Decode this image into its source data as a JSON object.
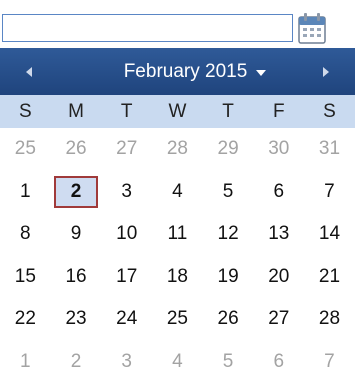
{
  "date_input": {
    "value": "",
    "placeholder": ""
  },
  "calendar": {
    "title": "February 2015",
    "weekdays": [
      "S",
      "M",
      "T",
      "W",
      "T",
      "F",
      "S"
    ],
    "weeks": [
      [
        "25",
        "26",
        "27",
        "28",
        "29",
        "30",
        "31"
      ],
      [
        "1",
        "2",
        "3",
        "4",
        "5",
        "6",
        "7"
      ],
      [
        "8",
        "9",
        "10",
        "11",
        "12",
        "13",
        "14"
      ],
      [
        "15",
        "16",
        "17",
        "18",
        "19",
        "20",
        "21"
      ],
      [
        "22",
        "23",
        "24",
        "25",
        "26",
        "27",
        "28"
      ],
      [
        "1",
        "2",
        "3",
        "4",
        "5",
        "6",
        "7"
      ]
    ],
    "other_month_weeks": [
      0,
      5
    ],
    "selected_day": "2",
    "colors": {
      "header": "#1f447d",
      "weekday_bar": "#c9daf0",
      "selected_border": "#a03a3a",
      "selected_fill": "#cfdcf1",
      "other_month_text": "#a3a3a3"
    },
    "icons": {
      "prev": "triangle-left-icon",
      "next": "triangle-right-icon",
      "title_dropdown": "triangle-down-icon",
      "picker": "calendar-icon"
    }
  }
}
